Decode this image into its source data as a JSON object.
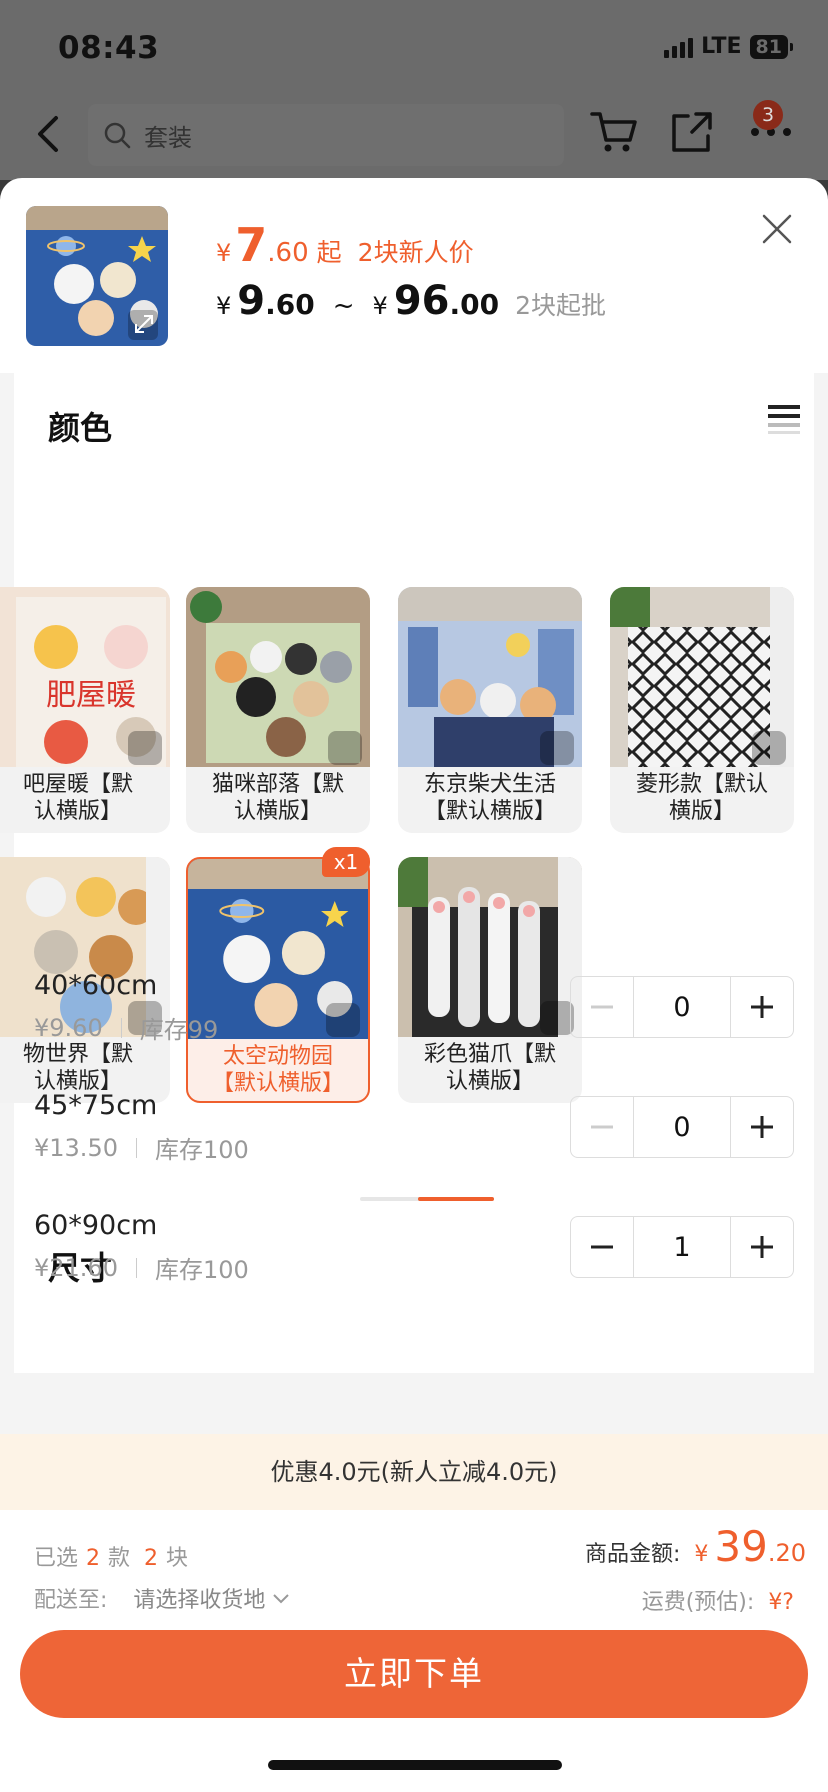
{
  "status": {
    "time": "08:43",
    "network": "LTE",
    "battery": "81"
  },
  "nav": {
    "search_placeholder": "套装",
    "cart_badge": "3"
  },
  "product": {
    "price_from": {
      "currency": "¥",
      "int": "7",
      "dec": ".60",
      "suffix": "起",
      "note": "2块新人价"
    },
    "price_range": {
      "currency": "¥",
      "low_int": "9",
      "low_dec": ".60",
      "tilde": "~",
      "high_int": "96",
      "high_dec": ".00",
      "moq": "2块起批"
    }
  },
  "color_section": {
    "title": "颜色",
    "items": [
      {
        "label": "肥屋暖【默认横版】",
        "line1": "吧屋暖【默",
        "line2": "认横版】",
        "selected": false
      },
      {
        "label": "猫咪部落【默认横版】",
        "line1": "猫咪部落【默",
        "line2": "认横版】",
        "selected": false
      },
      {
        "label": "东京柴犬生活【默认横版】",
        "line1": "东京柴犬生活",
        "line2": "【默认横版】",
        "selected": false
      },
      {
        "label": "菱形款【默认横版】",
        "line1": "菱形款【默认",
        "line2": "横版】",
        "selected": false
      },
      {
        "label": "动物世界【默认横版】",
        "line1": "物世界【默",
        "line2": "认横版】",
        "selected": false
      },
      {
        "label": "太空动物园【默认横版】",
        "line1": "太空动物园",
        "line2": "【默认横版】",
        "selected": true,
        "count": "x1"
      },
      {
        "label": "彩色猫爪【默认横版】",
        "line1": "彩色猫爪【默",
        "line2": "认横版】",
        "selected": false
      }
    ]
  },
  "size_section": {
    "title": "尺寸",
    "rows": [
      {
        "name": "40*60cm",
        "price": "¥9.60",
        "stock": "库存99",
        "qty": "0"
      },
      {
        "name": "45*75cm",
        "price": "¥13.50",
        "stock": "库存100",
        "qty": "0"
      },
      {
        "name": "60*90cm",
        "price": "¥21.60",
        "stock": "库存100",
        "qty": "1"
      }
    ]
  },
  "promo": "优惠4.0元(新人立减4.0元)",
  "footer": {
    "selected_prefix": "已选",
    "selected_styles": "2",
    "styles_unit": "款",
    "selected_pieces": "2",
    "pieces_unit": "块",
    "ship_label": "配送至:",
    "ship_value": "请选择收货地",
    "total_label": "商品金额:",
    "total_currency": "¥",
    "total_int": "39",
    "total_dec": ".20",
    "freight_label": "运费(预估):",
    "freight_value": "¥?",
    "order_button": "立即下单"
  },
  "colors": {
    "accent": "#ef5f2d",
    "promo_bg": "#fdf3e6"
  }
}
